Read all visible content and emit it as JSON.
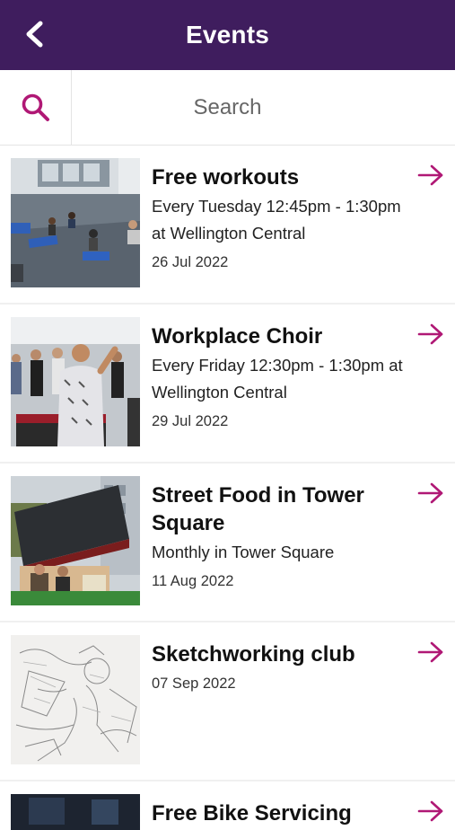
{
  "header": {
    "title": "Events",
    "back_icon": "chevron-left-icon",
    "background": "#3f1d5e"
  },
  "search": {
    "placeholder": "Search",
    "icon": "search-icon",
    "icon_color": "#b01875"
  },
  "accent_color": "#b01875",
  "events": [
    {
      "title": "Free workouts",
      "description": "Every Tuesday 12:45pm - 1:30pm at Wellington Central",
      "date": "26 Jul 2022"
    },
    {
      "title": "Workplace Choir",
      "description": "Every Friday 12:30pm - 1:30pm at Wellington Central",
      "date": "29 Jul 2022"
    },
    {
      "title": "Street Food in Tower Square",
      "description": "Monthly in Tower Square",
      "date": "11 Aug 2022"
    },
    {
      "title": "Sketchworking club",
      "description": "",
      "date": "07 Sep 2022"
    },
    {
      "title": "Free Bike Servicing",
      "description": "",
      "date": ""
    }
  ]
}
